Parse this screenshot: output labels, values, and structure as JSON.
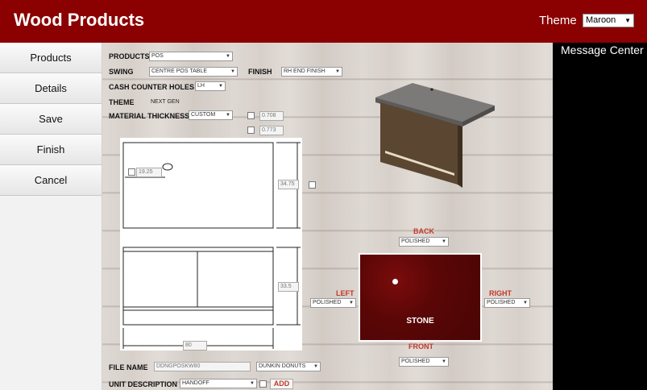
{
  "header": {
    "title": "Wood Products",
    "theme_label": "Theme",
    "theme_value": "Maroon"
  },
  "sidebar": {
    "items": [
      {
        "label": "Products"
      },
      {
        "label": "Details"
      },
      {
        "label": "Save"
      },
      {
        "label": "Finish"
      },
      {
        "label": "Cancel"
      }
    ]
  },
  "message_center": {
    "title": "Message Center"
  },
  "form": {
    "products_label": "PRODUCTS",
    "products_value": "POS",
    "swing_label": "SWING",
    "swing_value": "CENTRE POS TABLE",
    "finish_label": "FINISH",
    "finish_value": "RH END FINISH",
    "cash_label": "CASH COUNTER HOLES",
    "cash_value": "LH",
    "theme_label": "THEME",
    "theme_value": "NEXT GEN",
    "material_label": "MATERIAL THICKNESS",
    "material_value": "CUSTOM",
    "thickness_a": "0.708",
    "thickness_b": "0.773",
    "file_label": "FILE NAME",
    "file_value": "DDNGPOSKW80",
    "customer_value": "DUNKIN DONUTS",
    "unit_label": "UNIT DESCRIPTION",
    "unit_value": "HANDOFF",
    "add_label": "ADD"
  },
  "drawing": {
    "dim_hole": "19.25",
    "dim_depth": "34.75",
    "dim_height": "33.5",
    "dim_width": "80"
  },
  "finishes": {
    "back_label": "BACK",
    "back_value": "POLISHED",
    "left_label": "LEFT",
    "left_value": "POLISHED",
    "right_label": "RIGHT",
    "right_value": "POLISHED",
    "front_label": "FRONT",
    "front_value": "POLISHED",
    "stone_label": "STONE"
  },
  "colors": {
    "header": "#8b0000",
    "stone": "#5a0606",
    "accent_label": "#c0392b"
  }
}
